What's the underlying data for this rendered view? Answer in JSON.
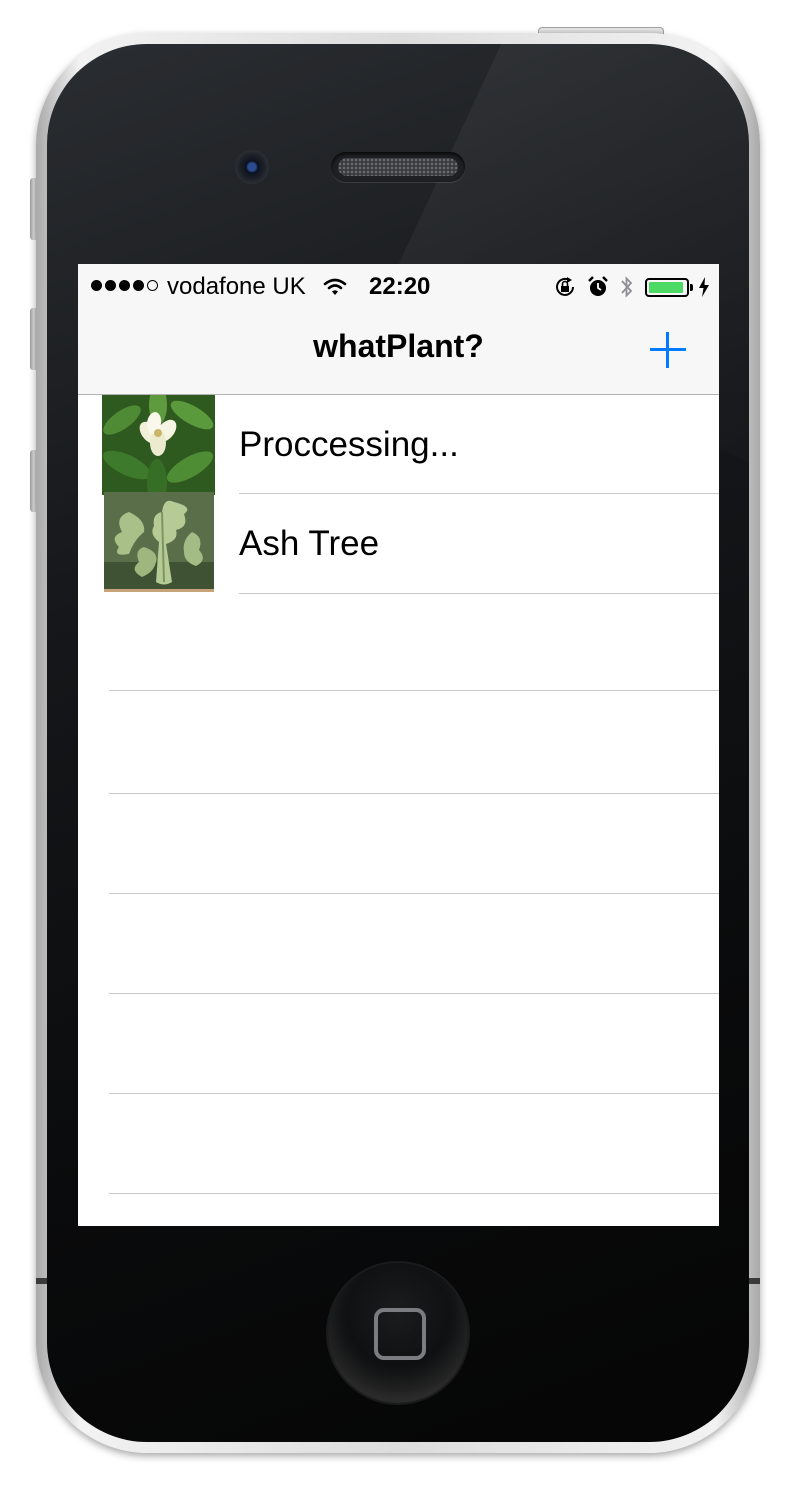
{
  "status_bar": {
    "carrier": "vodafone UK",
    "time": "22:20",
    "signal_bars_filled": 4,
    "signal_bars_total": 5,
    "battery_level": 0.95,
    "battery_color": "#4cd964",
    "icons": [
      "signal-dots-icon",
      "wifi-icon",
      "orientation-lock-icon",
      "alarm-icon",
      "bluetooth-icon",
      "battery-icon",
      "charging-bolt-icon"
    ]
  },
  "nav": {
    "title": "whatPlant?",
    "add_icon": "plus-icon",
    "accent_color": "#007aff"
  },
  "list": {
    "items": [
      {
        "label": "Proccessing...",
        "thumbnail": "magnolia-flower-thumbnail"
      },
      {
        "label": "Ash Tree",
        "thumbnail": "oak-leaf-thumbnail"
      }
    ]
  }
}
